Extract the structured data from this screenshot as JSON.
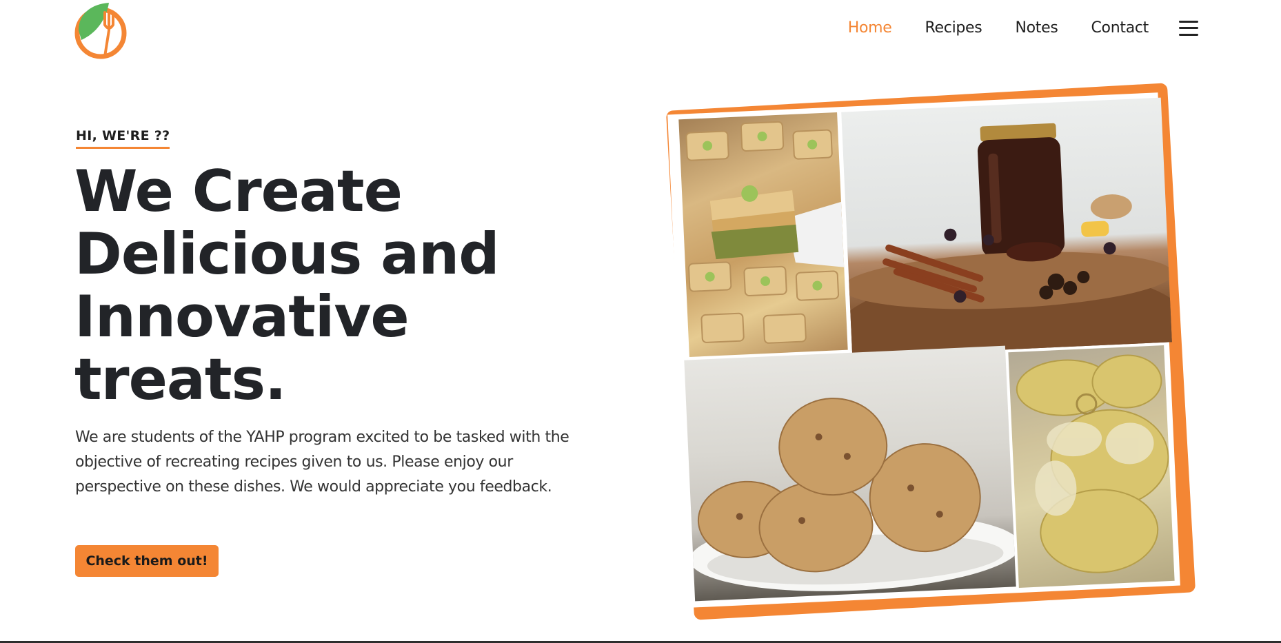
{
  "nav": {
    "items": [
      {
        "label": "Home",
        "active": true
      },
      {
        "label": "Recipes",
        "active": false
      },
      {
        "label": "Notes",
        "active": false
      },
      {
        "label": "Contact",
        "active": false
      }
    ],
    "menu_icon": "hamburger-menu-icon"
  },
  "logo": {
    "icon": "leaf-fork-logo",
    "colors": [
      "#5bb75b",
      "#f48634"
    ]
  },
  "hero": {
    "eyebrow": "HI, WE'RE ??",
    "title_lines": [
      "We Create",
      "Delicious and",
      "Innovative",
      "treats."
    ],
    "description": "We are students of the YAHP program excited to be tasked with the objective of recreating recipes given to us. Please enjoy our perspective on these dishes. We would appreciate you feedback.",
    "cta_label": "Check them out!"
  },
  "colors": {
    "accent": "#f48634",
    "text": "#222428"
  }
}
